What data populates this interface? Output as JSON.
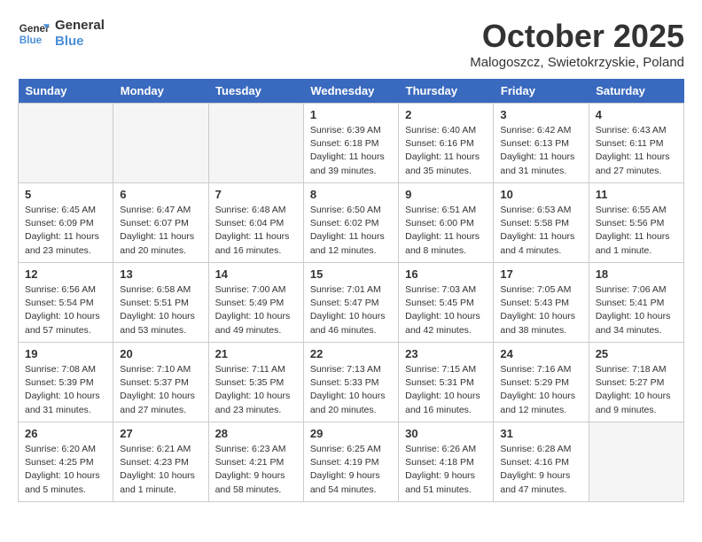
{
  "header": {
    "logo_line1": "General",
    "logo_line2": "Blue",
    "month": "October 2025",
    "location": "Malogoszcz, Swietokrzyskie, Poland"
  },
  "days_of_week": [
    "Sunday",
    "Monday",
    "Tuesday",
    "Wednesday",
    "Thursday",
    "Friday",
    "Saturday"
  ],
  "weeks": [
    [
      {
        "num": "",
        "info": "",
        "empty": true
      },
      {
        "num": "",
        "info": "",
        "empty": true
      },
      {
        "num": "",
        "info": "",
        "empty": true
      },
      {
        "num": "1",
        "info": "Sunrise: 6:39 AM\nSunset: 6:18 PM\nDaylight: 11 hours\nand 39 minutes.",
        "empty": false
      },
      {
        "num": "2",
        "info": "Sunrise: 6:40 AM\nSunset: 6:16 PM\nDaylight: 11 hours\nand 35 minutes.",
        "empty": false
      },
      {
        "num": "3",
        "info": "Sunrise: 6:42 AM\nSunset: 6:13 PM\nDaylight: 11 hours\nand 31 minutes.",
        "empty": false
      },
      {
        "num": "4",
        "info": "Sunrise: 6:43 AM\nSunset: 6:11 PM\nDaylight: 11 hours\nand 27 minutes.",
        "empty": false
      }
    ],
    [
      {
        "num": "5",
        "info": "Sunrise: 6:45 AM\nSunset: 6:09 PM\nDaylight: 11 hours\nand 23 minutes.",
        "empty": false
      },
      {
        "num": "6",
        "info": "Sunrise: 6:47 AM\nSunset: 6:07 PM\nDaylight: 11 hours\nand 20 minutes.",
        "empty": false
      },
      {
        "num": "7",
        "info": "Sunrise: 6:48 AM\nSunset: 6:04 PM\nDaylight: 11 hours\nand 16 minutes.",
        "empty": false
      },
      {
        "num": "8",
        "info": "Sunrise: 6:50 AM\nSunset: 6:02 PM\nDaylight: 11 hours\nand 12 minutes.",
        "empty": false
      },
      {
        "num": "9",
        "info": "Sunrise: 6:51 AM\nSunset: 6:00 PM\nDaylight: 11 hours\nand 8 minutes.",
        "empty": false
      },
      {
        "num": "10",
        "info": "Sunrise: 6:53 AM\nSunset: 5:58 PM\nDaylight: 11 hours\nand 4 minutes.",
        "empty": false
      },
      {
        "num": "11",
        "info": "Sunrise: 6:55 AM\nSunset: 5:56 PM\nDaylight: 11 hours\nand 1 minute.",
        "empty": false
      }
    ],
    [
      {
        "num": "12",
        "info": "Sunrise: 6:56 AM\nSunset: 5:54 PM\nDaylight: 10 hours\nand 57 minutes.",
        "empty": false
      },
      {
        "num": "13",
        "info": "Sunrise: 6:58 AM\nSunset: 5:51 PM\nDaylight: 10 hours\nand 53 minutes.",
        "empty": false
      },
      {
        "num": "14",
        "info": "Sunrise: 7:00 AM\nSunset: 5:49 PM\nDaylight: 10 hours\nand 49 minutes.",
        "empty": false
      },
      {
        "num": "15",
        "info": "Sunrise: 7:01 AM\nSunset: 5:47 PM\nDaylight: 10 hours\nand 46 minutes.",
        "empty": false
      },
      {
        "num": "16",
        "info": "Sunrise: 7:03 AM\nSunset: 5:45 PM\nDaylight: 10 hours\nand 42 minutes.",
        "empty": false
      },
      {
        "num": "17",
        "info": "Sunrise: 7:05 AM\nSunset: 5:43 PM\nDaylight: 10 hours\nand 38 minutes.",
        "empty": false
      },
      {
        "num": "18",
        "info": "Sunrise: 7:06 AM\nSunset: 5:41 PM\nDaylight: 10 hours\nand 34 minutes.",
        "empty": false
      }
    ],
    [
      {
        "num": "19",
        "info": "Sunrise: 7:08 AM\nSunset: 5:39 PM\nDaylight: 10 hours\nand 31 minutes.",
        "empty": false
      },
      {
        "num": "20",
        "info": "Sunrise: 7:10 AM\nSunset: 5:37 PM\nDaylight: 10 hours\nand 27 minutes.",
        "empty": false
      },
      {
        "num": "21",
        "info": "Sunrise: 7:11 AM\nSunset: 5:35 PM\nDaylight: 10 hours\nand 23 minutes.",
        "empty": false
      },
      {
        "num": "22",
        "info": "Sunrise: 7:13 AM\nSunset: 5:33 PM\nDaylight: 10 hours\nand 20 minutes.",
        "empty": false
      },
      {
        "num": "23",
        "info": "Sunrise: 7:15 AM\nSunset: 5:31 PM\nDaylight: 10 hours\nand 16 minutes.",
        "empty": false
      },
      {
        "num": "24",
        "info": "Sunrise: 7:16 AM\nSunset: 5:29 PM\nDaylight: 10 hours\nand 12 minutes.",
        "empty": false
      },
      {
        "num": "25",
        "info": "Sunrise: 7:18 AM\nSunset: 5:27 PM\nDaylight: 10 hours\nand 9 minutes.",
        "empty": false
      }
    ],
    [
      {
        "num": "26",
        "info": "Sunrise: 6:20 AM\nSunset: 4:25 PM\nDaylight: 10 hours\nand 5 minutes.",
        "empty": false
      },
      {
        "num": "27",
        "info": "Sunrise: 6:21 AM\nSunset: 4:23 PM\nDaylight: 10 hours\nand 1 minute.",
        "empty": false
      },
      {
        "num": "28",
        "info": "Sunrise: 6:23 AM\nSunset: 4:21 PM\nDaylight: 9 hours\nand 58 minutes.",
        "empty": false
      },
      {
        "num": "29",
        "info": "Sunrise: 6:25 AM\nSunset: 4:19 PM\nDaylight: 9 hours\nand 54 minutes.",
        "empty": false
      },
      {
        "num": "30",
        "info": "Sunrise: 6:26 AM\nSunset: 4:18 PM\nDaylight: 9 hours\nand 51 minutes.",
        "empty": false
      },
      {
        "num": "31",
        "info": "Sunrise: 6:28 AM\nSunset: 4:16 PM\nDaylight: 9 hours\nand 47 minutes.",
        "empty": false
      },
      {
        "num": "",
        "info": "",
        "empty": true
      }
    ]
  ]
}
